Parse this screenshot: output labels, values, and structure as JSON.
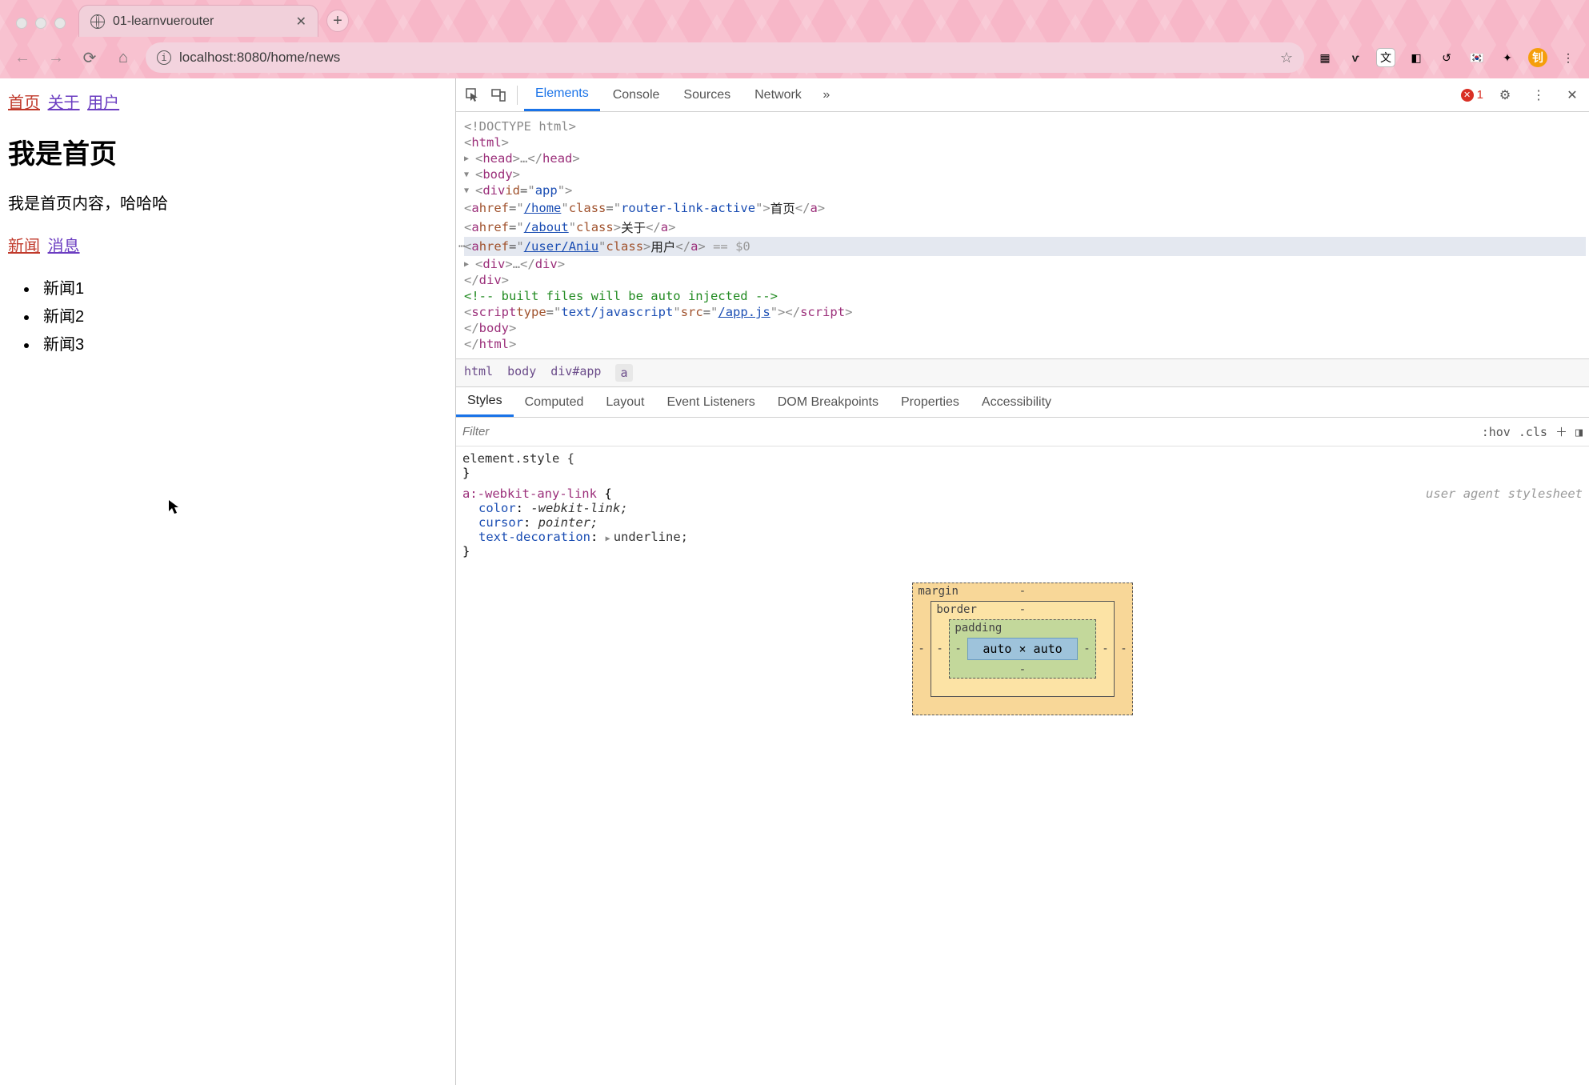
{
  "browser": {
    "tab_title": "01-learnvuerouter",
    "url": "localhost:8080/home/news"
  },
  "page": {
    "nav": [
      {
        "label": "首页",
        "active": true
      },
      {
        "label": "关于",
        "active": false
      },
      {
        "label": "用户",
        "active": false
      }
    ],
    "heading": "我是首页",
    "content": "我是首页内容，哈哈哈",
    "subnav": [
      {
        "label": "新闻",
        "active": true
      },
      {
        "label": "消息",
        "active": false
      }
    ],
    "news_items": [
      "新闻1",
      "新闻2",
      "新闻3"
    ]
  },
  "devtools": {
    "tabs": [
      "Elements",
      "Console",
      "Sources",
      "Network"
    ],
    "active_tab": "Elements",
    "error_count": "1",
    "dom": {
      "doctype": "<!DOCTYPE html>",
      "app_tag": "div",
      "app_id": "app",
      "links": [
        {
          "href": "/home",
          "class": "router-link-active",
          "text": "首页",
          "selected": false
        },
        {
          "href": "/about",
          "class": "",
          "text": "关于",
          "selected": false
        },
        {
          "href": "/user/Aniu",
          "class": "",
          "text": "用户",
          "selected": true
        }
      ],
      "sel_ghost": " == $0",
      "comment": "<!-- built files will be auto injected -->",
      "script_type": "text/javascript",
      "script_src": "/app.js"
    },
    "breadcrumb": [
      "html",
      "body",
      "div#app",
      "a"
    ],
    "styles_tabs": [
      "Styles",
      "Computed",
      "Layout",
      "Event Listeners",
      "DOM Breakpoints",
      "Properties",
      "Accessibility"
    ],
    "filter_placeholder": "Filter",
    "hov_label": ":hov",
    "cls_label": ".cls",
    "rules": {
      "el_style": "element.style {",
      "selector": "a:-webkit-any-link",
      "uas": "user agent stylesheet",
      "props": [
        {
          "n": "color",
          "v": "-webkit-link;"
        },
        {
          "n": "cursor",
          "v": "pointer;"
        },
        {
          "n": "text-decoration",
          "v": "underline;",
          "expandable": true
        }
      ]
    },
    "boxmodel": {
      "margin_label": "margin",
      "border_label": "border",
      "padding_label": "padding",
      "content": "auto × auto",
      "dash": "-"
    }
  }
}
